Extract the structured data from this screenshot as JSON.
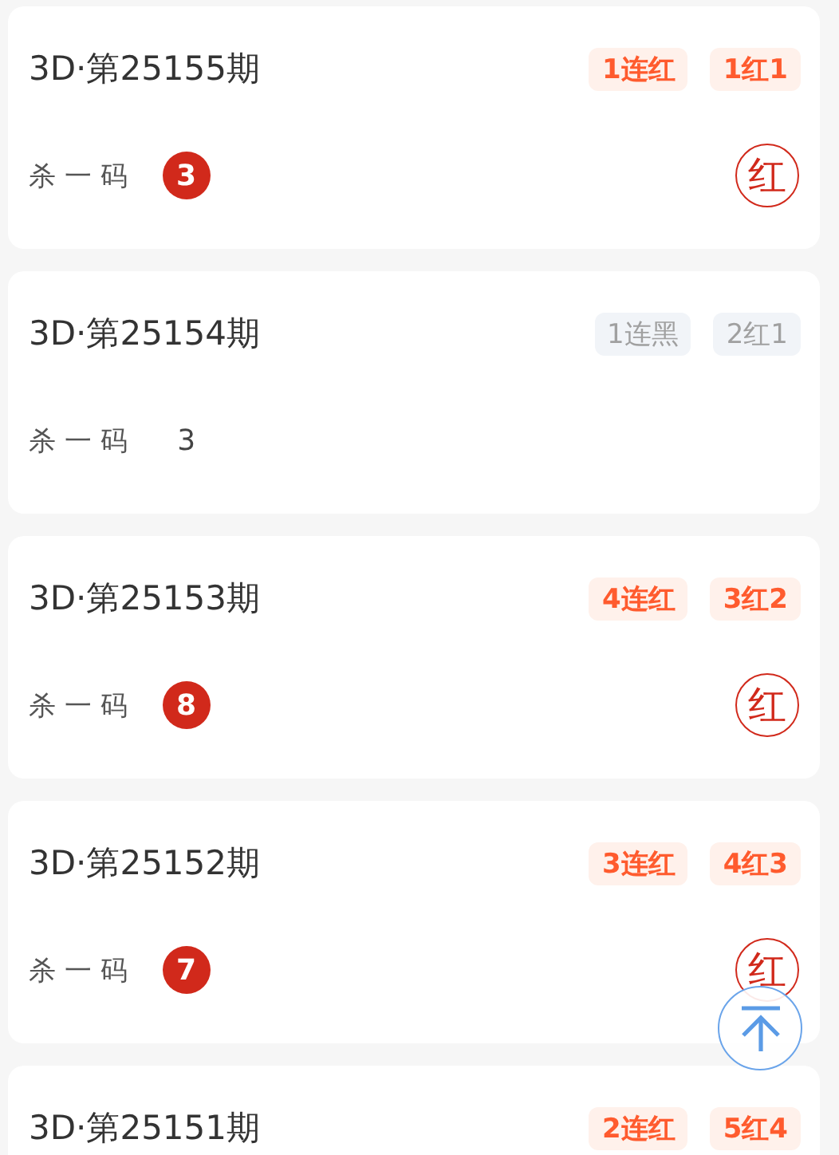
{
  "cards": [
    {
      "title": "3D·第25155期",
      "badges": [
        {
          "text": "1连红",
          "kind": "red"
        },
        {
          "text": "1红1",
          "kind": "red"
        }
      ],
      "kill_label": "杀 一 码",
      "kill_number": "3",
      "hit": true,
      "result": "红"
    },
    {
      "title": "3D·第25154期",
      "badges": [
        {
          "text": "1连黑",
          "kind": "gray"
        },
        {
          "text": "2红1",
          "kind": "gray"
        }
      ],
      "kill_label": "杀 一 码",
      "kill_number": "3",
      "hit": false
    },
    {
      "title": "3D·第25153期",
      "badges": [
        {
          "text": "4连红",
          "kind": "red"
        },
        {
          "text": "3红2",
          "kind": "red"
        }
      ],
      "kill_label": "杀 一 码",
      "kill_number": "8",
      "hit": true,
      "result": "红"
    },
    {
      "title": "3D·第25152期",
      "badges": [
        {
          "text": "3连红",
          "kind": "red"
        },
        {
          "text": "4红3",
          "kind": "red"
        }
      ],
      "kill_label": "杀 一 码",
      "kill_number": "7",
      "hit": true,
      "result": "红"
    },
    {
      "title": "3D·第25151期",
      "badges": [
        {
          "text": "2连红",
          "kind": "red"
        },
        {
          "text": "5红4",
          "kind": "red"
        }
      ]
    }
  ]
}
